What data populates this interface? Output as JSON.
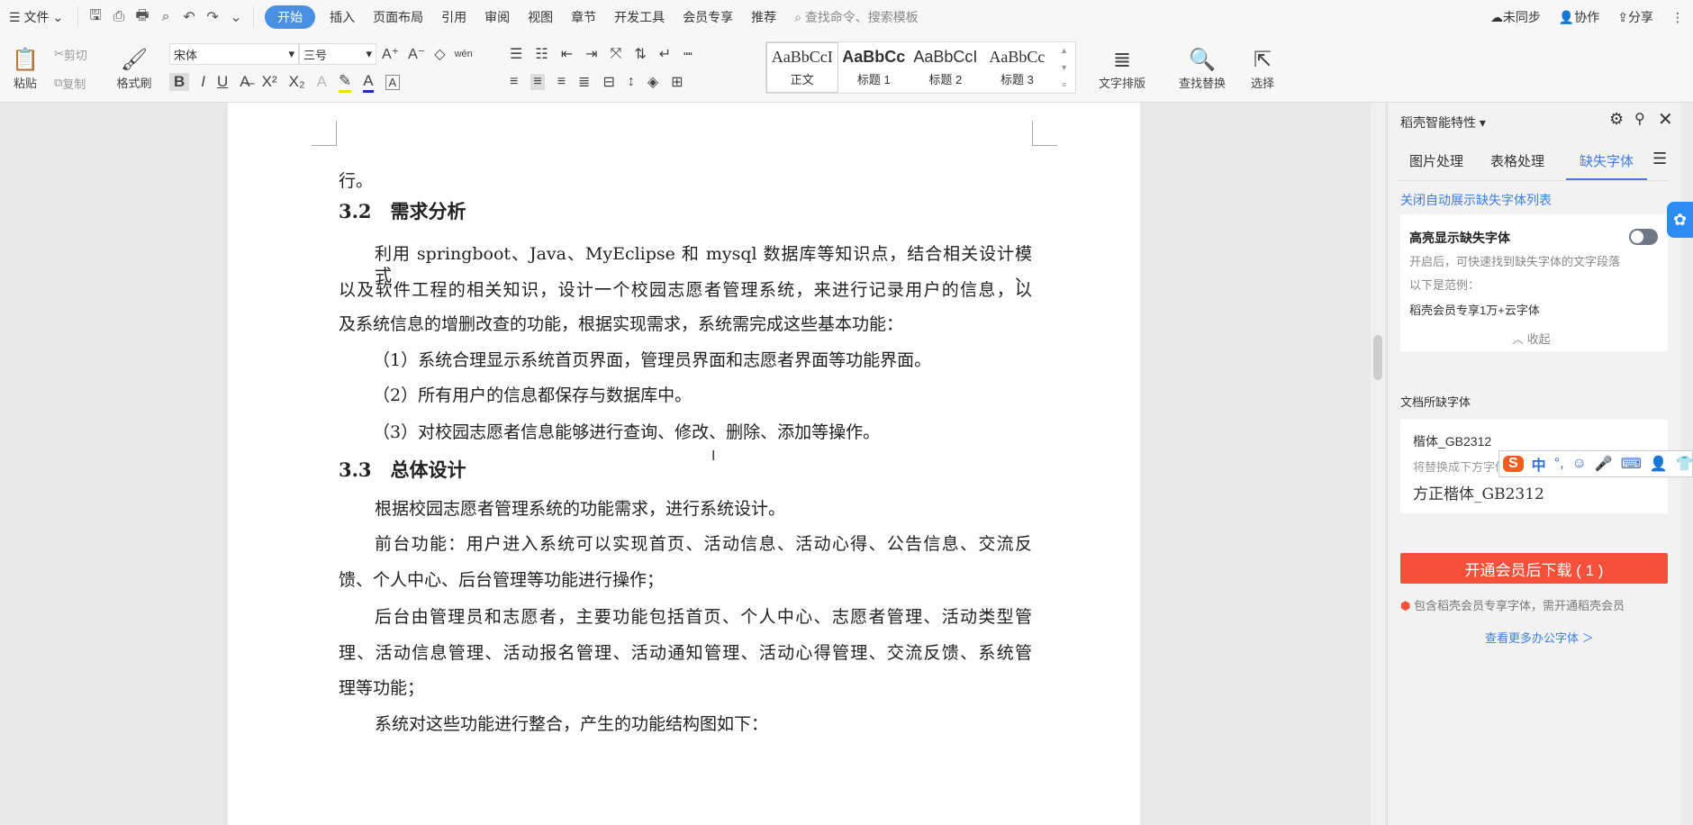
{
  "topbar": {
    "menu": "文件",
    "tabs": [
      "开始",
      "插入",
      "页面布局",
      "引用",
      "审阅",
      "视图",
      "章节",
      "开发工具",
      "会员专享",
      "推荐"
    ],
    "search_placeholder": "查找命令、搜索模板",
    "sync": "未同步",
    "collab": "协作",
    "share": "分享"
  },
  "ribbon": {
    "paste": "粘贴",
    "cut": "剪切",
    "copy": "复制",
    "format_painter": "格式刷",
    "font_name": "宋体",
    "font_size": "三号",
    "pinyin": "wén",
    "styles": [
      {
        "preview": "AaBbCcI",
        "label": "正文"
      },
      {
        "preview": "AaBbCc",
        "label": "标题 1"
      },
      {
        "preview": "AaBbCcI",
        "label": "标题 2"
      },
      {
        "preview": "AaBbCc",
        "label": "标题 3"
      }
    ],
    "text_layout": "文字排版",
    "find_replace": "查找替换",
    "select": "选择",
    "accent": "#4a90e2"
  },
  "document": {
    "lines": [
      "行。",
      "3.2　需求分析",
      "利用 springboot、Java、MyEclipse 和 mysql 数据库等知识点，结合相关设计模式、",
      "以及软件工程的相关知识，设计一个校园志愿者管理系统，来进行记录用户的信息，以",
      "及系统信息的增删改查的功能，根据实现需求，系统需完成这些基本功能：",
      "（1）系统合理显示系统首页界面，管理员界面和志愿者界面等功能界面。",
      "（2）所有用户的信息都保存与数据库中。",
      "（3）对校园志愿者信息能够进行查询、修改、删除、添加等操作。",
      "3.3　总体设计",
      "根据校园志愿者管理系统的功能需求，进行系统设计。",
      "前台功能：用户进入系统可以实现首页、活动信息、活动心得、公告信息、交流反",
      "馈、个人中心、后台管理等功能进行操作；",
      "后台由管理员和志愿者，主要功能包括首页、个人中心、志愿者管理、活动类型管",
      "理、活动信息管理、活动报名管理、活动通知管理、活动心得管理、交流反馈、系统管",
      "理等功能；",
      "系统对这些功能进行整合，产生的功能结构图如下："
    ]
  },
  "sidebar": {
    "title": "稻壳智能特性",
    "tabs": [
      "图片处理",
      "表格处理",
      "缺失字体"
    ],
    "close_auto": "关闭自动展示缺失字体列表",
    "highlight_title": "高亮显示缺失字体",
    "highlight_on": false,
    "highlight_desc": "开启后，可快速找到缺失字体的文字段落",
    "example_label": "以下是范例：",
    "example_text": "稻壳会员专享1万+云字体",
    "collapse": "收起",
    "missing_title": "文档所缺字体",
    "missing_font": "楷体_GB2312",
    "replace_label": "将替换成下方字体",
    "replacement_font": "方正楷体_GB2312",
    "download_button": "开通会员后下载 ( 1 )",
    "member_note": "包含稻壳会员专享字体，需开通稻壳会员",
    "more_fonts": "查看更多办公字体 ＞",
    "button_color": "#f5503a"
  },
  "ime": {
    "mode": "中",
    "punct": "°,"
  }
}
